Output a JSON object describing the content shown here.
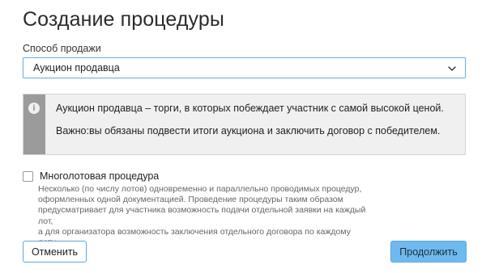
{
  "page": {
    "title": "Создание процедуры"
  },
  "sale_method": {
    "label": "Способ продажи",
    "selected": "Аукцион продавца",
    "icon": "chevron-down-icon"
  },
  "info": {
    "icon": "info-icon",
    "line1": "Аукцион продавца – торги, в которых побеждает участник с самой высокой ценой.",
    "line2": "Важно:вы обязаны подвести итоги аукциона и заключить договор с победителем."
  },
  "multilot": {
    "label": "Многолотовая процедура",
    "checked": false,
    "help_lines": [
      "Несколько (по числу лотов) одновременно и параллельно проводимых процедур,",
      "оформленных одной документацией. Проведение процедуры таким образом",
      "предусматривает для участника возможность подачи отдельной заявки на каждый лот,",
      "а для организатора возможность заключения отдельного договора по каждому лоту."
    ]
  },
  "actions": {
    "cancel_label": "Отменить",
    "continue_label": "Продолжить"
  },
  "colors": {
    "accent": "#6ebaf0",
    "accent_border": "#5aa9df",
    "info_stripe": "#9b9b9b",
    "info_bg": "#f0f0f0"
  }
}
